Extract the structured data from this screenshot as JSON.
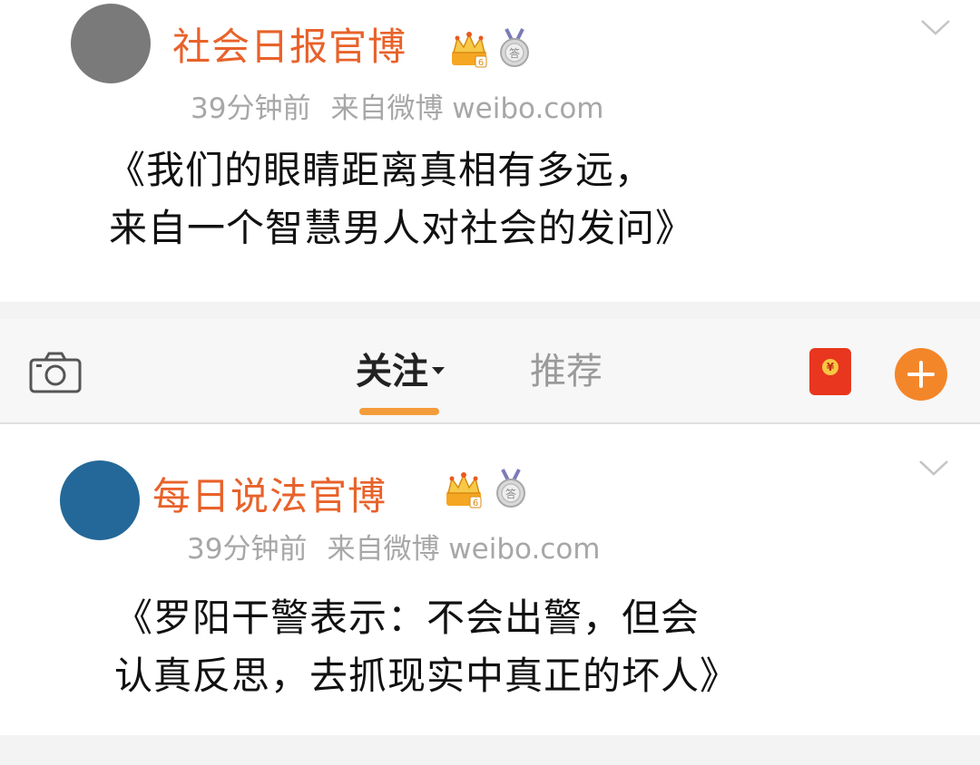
{
  "posts": [
    {
      "author": "社会日报官博",
      "avatar_color": "#7a7a7a",
      "badges": [
        "crown-badge-icon",
        "medal-badge-icon"
      ],
      "time": "39分钟前",
      "source": "来自微博 weibo.com",
      "text_lines": [
        "《我们的眼睛距离真相有多远，",
        "来自一个智慧男人对社会的发问》"
      ]
    },
    {
      "author": "每日说法官博",
      "avatar_color": "#236898",
      "badges": [
        "crown-badge-icon",
        "medal-badge-icon"
      ],
      "time": "39分钟前",
      "source": "来自微博 weibo.com",
      "text_lines": [
        "《罗阳干警表示：不会出警，但会",
        "认真反思，去抓现实中真正的坏人》"
      ]
    }
  ],
  "tabbar": {
    "tabs": [
      {
        "label": "关注",
        "active": true
      },
      {
        "label": "推荐",
        "active": false
      }
    ],
    "accent_color": "#f4862a",
    "redpacket_color": "#e8361f"
  }
}
